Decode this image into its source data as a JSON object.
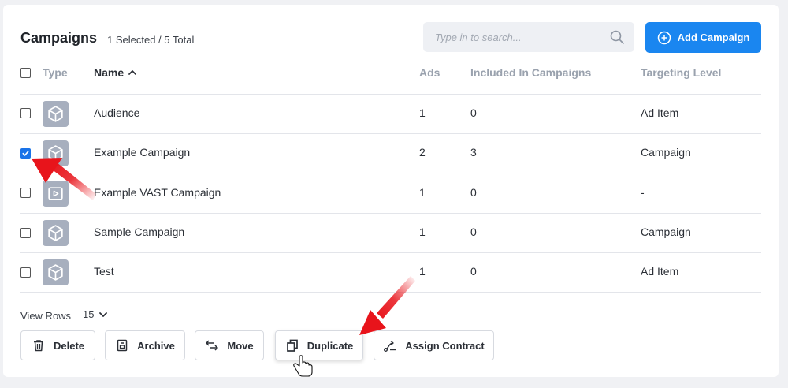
{
  "header": {
    "title": "Campaigns",
    "selection_count": "1 Selected / 5 Total"
  },
  "search": {
    "placeholder": "Type in to search...",
    "value": ""
  },
  "add_button": {
    "label": "Add Campaign",
    "icon": "plus-circle-icon"
  },
  "columns": {
    "type": "Type",
    "name": "Name",
    "ads": "Ads",
    "included": "Included In Campaigns",
    "targeting": "Targeting Level"
  },
  "sort": {
    "column": "Name",
    "direction": "ascending"
  },
  "rows": [
    {
      "type_icon": "cube-icon",
      "name": "Audience",
      "ads": "1",
      "included": "0",
      "targeting": "Ad Item",
      "selected": false
    },
    {
      "type_icon": "cube-icon",
      "name": "Example Campaign",
      "ads": "2",
      "included": "3",
      "targeting": "Campaign",
      "selected": true
    },
    {
      "type_icon": "video-play-icon",
      "name": "Example VAST Campaign",
      "ads": "1",
      "included": "0",
      "targeting": "-",
      "selected": false
    },
    {
      "type_icon": "cube-icon",
      "name": "Sample Campaign",
      "ads": "1",
      "included": "0",
      "targeting": "Campaign",
      "selected": false
    },
    {
      "type_icon": "cube-icon",
      "name": "Test",
      "ads": "1",
      "included": "0",
      "targeting": "Ad Item",
      "selected": false
    }
  ],
  "pagination": {
    "view_rows_label": "View Rows",
    "view_rows_value": "15"
  },
  "actions": [
    {
      "label": "Delete",
      "icon": "trash-icon"
    },
    {
      "label": "Archive",
      "icon": "archive-icon"
    },
    {
      "label": "Move",
      "icon": "move-arrows-icon"
    },
    {
      "label": "Duplicate",
      "icon": "copy-icon"
    },
    {
      "label": "Assign Contract",
      "icon": "assign-icon"
    }
  ],
  "colors": {
    "primary": "#1a86f0",
    "checkbox_checked": "#1a73e8",
    "type_icon_bg": "#a7afbe",
    "annotation_arrow": "#e8141b"
  }
}
